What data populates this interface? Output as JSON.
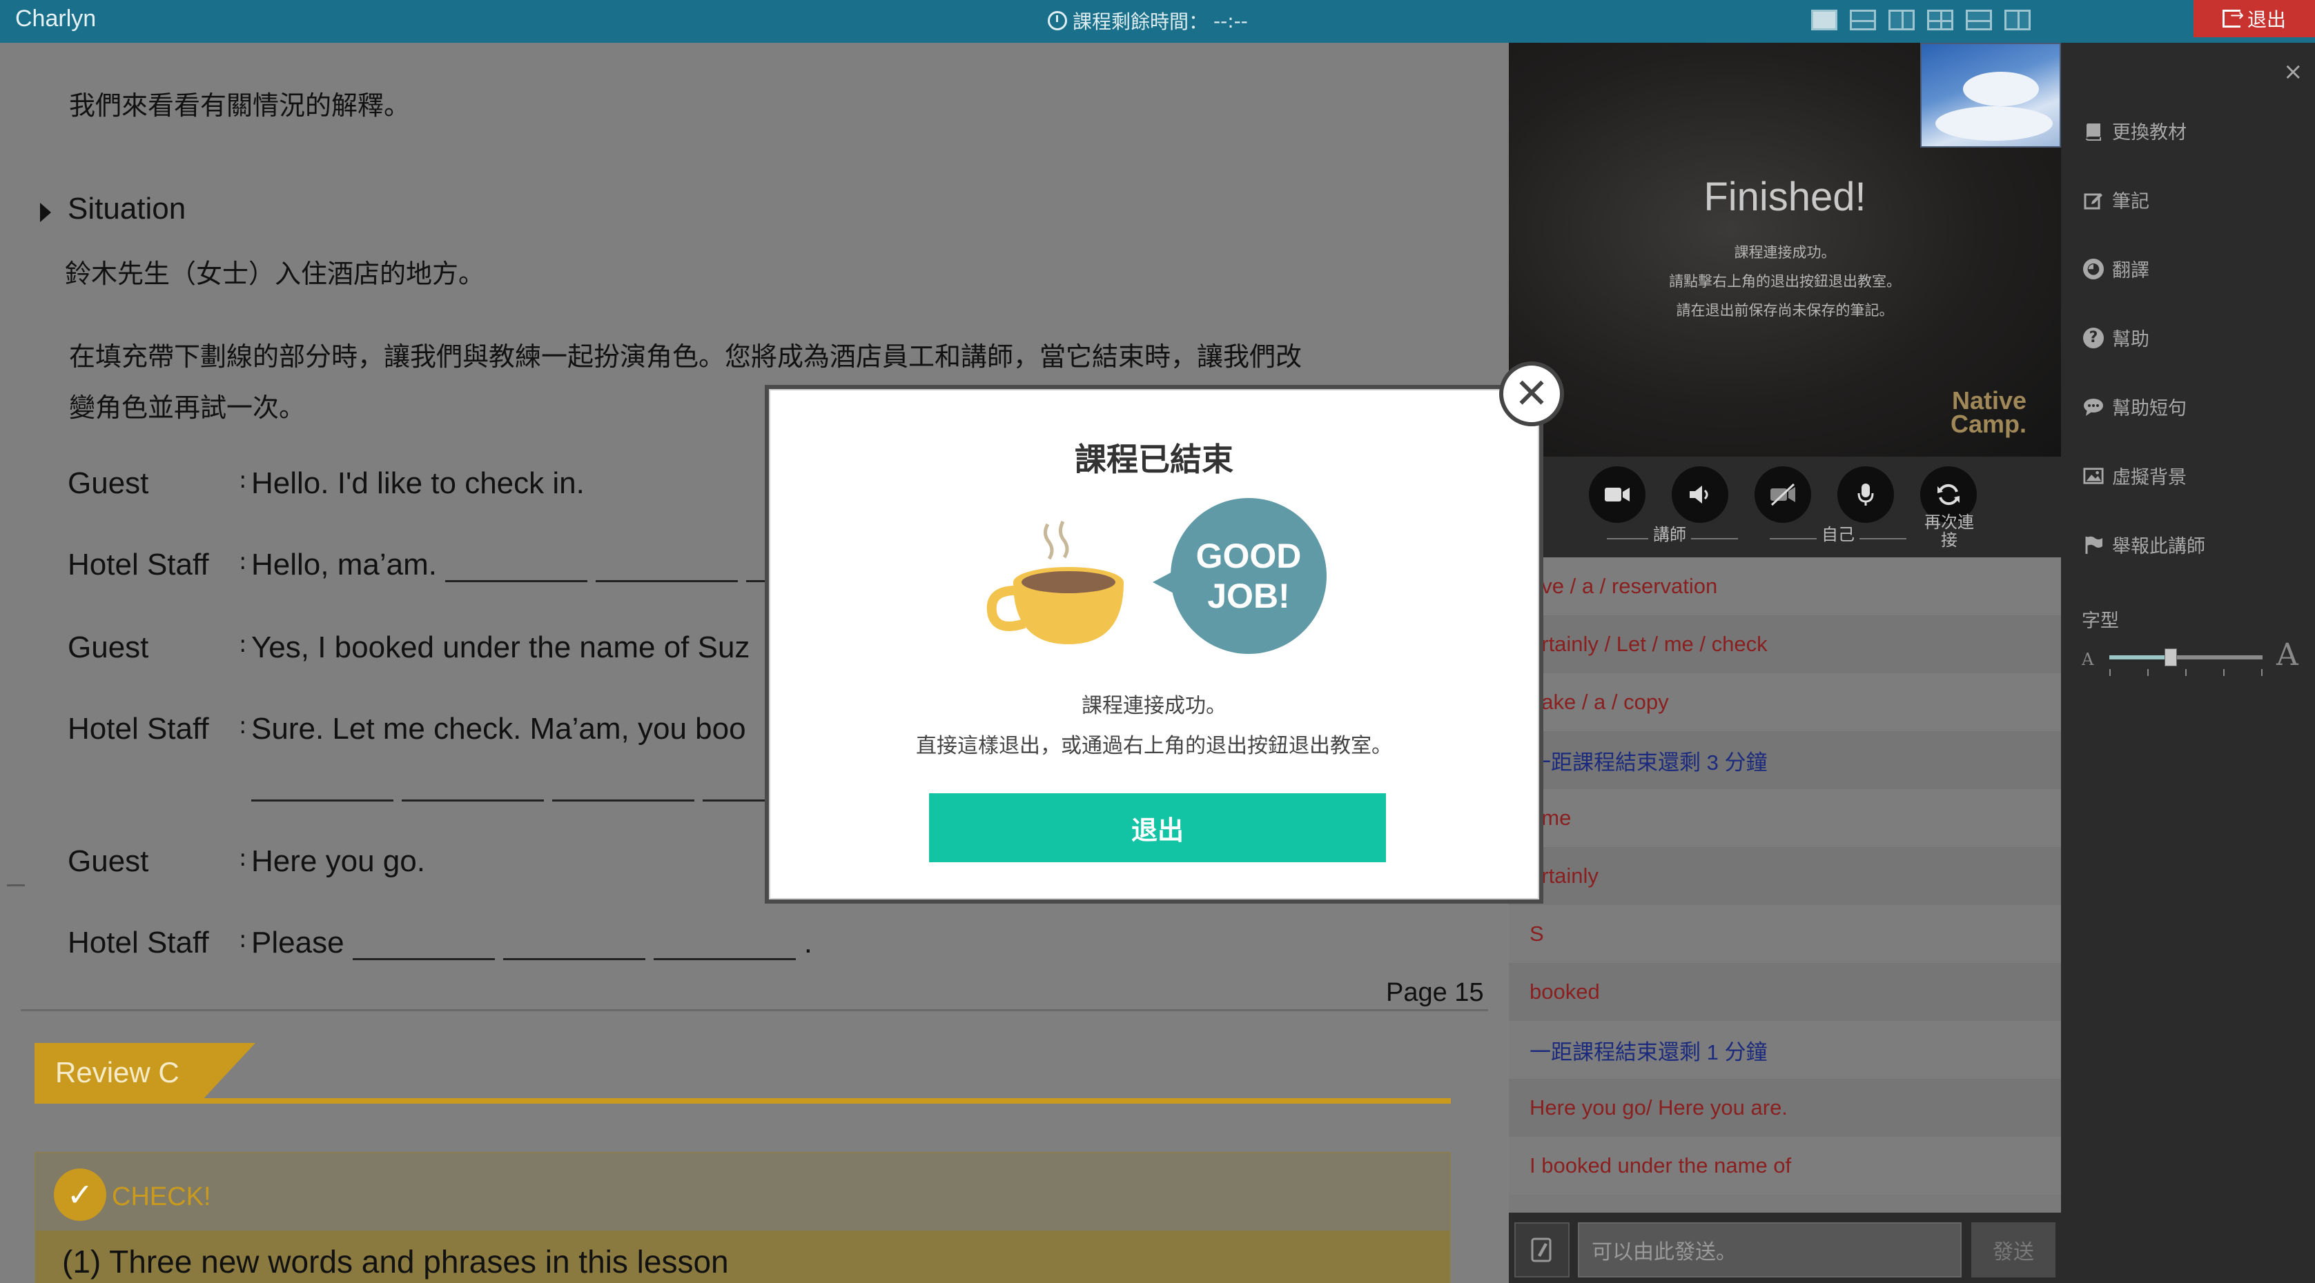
{
  "app": {
    "name": "Charlyn",
    "timer_label": "課程剩餘時間：",
    "timer_value": "--:--",
    "exit_label": "退出"
  },
  "material": {
    "intro": "我們來看看有關情況的解釋。",
    "situation_heading": "Situation",
    "situation_text": "鈴木先生（女士）入住酒店的地方。",
    "instruction_line1": "在填充帶下劃線的部分時，讓我們與教練一起扮演角色。您將成為酒店員工和講師，當它結束時，讓我們改",
    "instruction_line2": "變角色並再試一次。",
    "dialogue": [
      {
        "speaker": "Guest",
        "text": "Hello. I'd like to check in."
      },
      {
        "speaker": "Hotel Staff",
        "text": "Hello, ma’am."
      },
      {
        "speaker": "Guest",
        "text": "Yes, I booked under the name of Suz"
      },
      {
        "speaker": "Hotel Staff",
        "text": "Sure. Let me check. Ma’am, you boo"
      },
      {
        "speaker": "Guest",
        "text": "Here you go."
      },
      {
        "speaker": "Hotel Staff",
        "text": "Please"
      }
    ],
    "page": "Page 15",
    "review_tab": "Review C",
    "check_label": "CHECK!",
    "check_question": "(1) Three new words and phrases in this lesson"
  },
  "video": {
    "finished": "Finished!",
    "line1": "課程連接成功。",
    "line2": "請點擊右上角的退出按鈕退出教室。",
    "line3": "請在退出前保存尚未保存的筆記。",
    "logo_line1": "Native",
    "logo_line2": "Camp.",
    "label_teacher": "講師",
    "label_self": "自己",
    "label_reconnect_1": "再次連",
    "label_reconnect_2": "接"
  },
  "chat": {
    "messages": [
      {
        "text": "ave / a / reservation",
        "color": "red"
      },
      {
        "text": "ertainly / Let / me / check",
        "color": "red"
      },
      {
        "text": "nake / a / copy",
        "color": "red"
      },
      {
        "text": "一距課程結束還剩 3 分鐘",
        "color": "blue"
      },
      {
        "text": "ame",
        "color": "red"
      },
      {
        "text": "ertainly",
        "color": "red"
      },
      {
        "text": "S",
        "color": "red"
      },
      {
        "text": "booked",
        "color": "red"
      },
      {
        "text": "一距課程結束還剩 1 分鐘",
        "color": "blue"
      },
      {
        "text": "Here you go/ Here you are.",
        "color": "red"
      },
      {
        "text": "I booked under the name of",
        "color": "red"
      }
    ],
    "input_placeholder": "可以由此發送。",
    "send_label": "發送"
  },
  "sidebar": {
    "items": [
      {
        "label": "更換教材",
        "icon": "book-icon"
      },
      {
        "label": "筆記",
        "icon": "edit-icon"
      },
      {
        "label": "翻譯",
        "icon": "globe-icon"
      },
      {
        "label": "幫助",
        "icon": "help-icon"
      },
      {
        "label": "幫助短句",
        "icon": "chat-bubble-icon"
      },
      {
        "label": "虛擬背景",
        "icon": "image-icon"
      },
      {
        "label": "舉報此講師",
        "icon": "flag-icon"
      }
    ],
    "font_label": "字型",
    "font_small": "A",
    "font_large": "A",
    "font_size_level": 0.4
  },
  "modal": {
    "title": "課程已結束",
    "bubble_line1": "GOOD",
    "bubble_line2": "JOB!",
    "line1": "課程連接成功。",
    "line2": "直接這樣退出，或通過右上角的退出按鈕退出教室。",
    "exit_button": "退出"
  },
  "colors": {
    "accent": "#12c3a4",
    "topbar": "#1a6f8a",
    "danger": "#c9332f",
    "review": "#c99a1d"
  }
}
